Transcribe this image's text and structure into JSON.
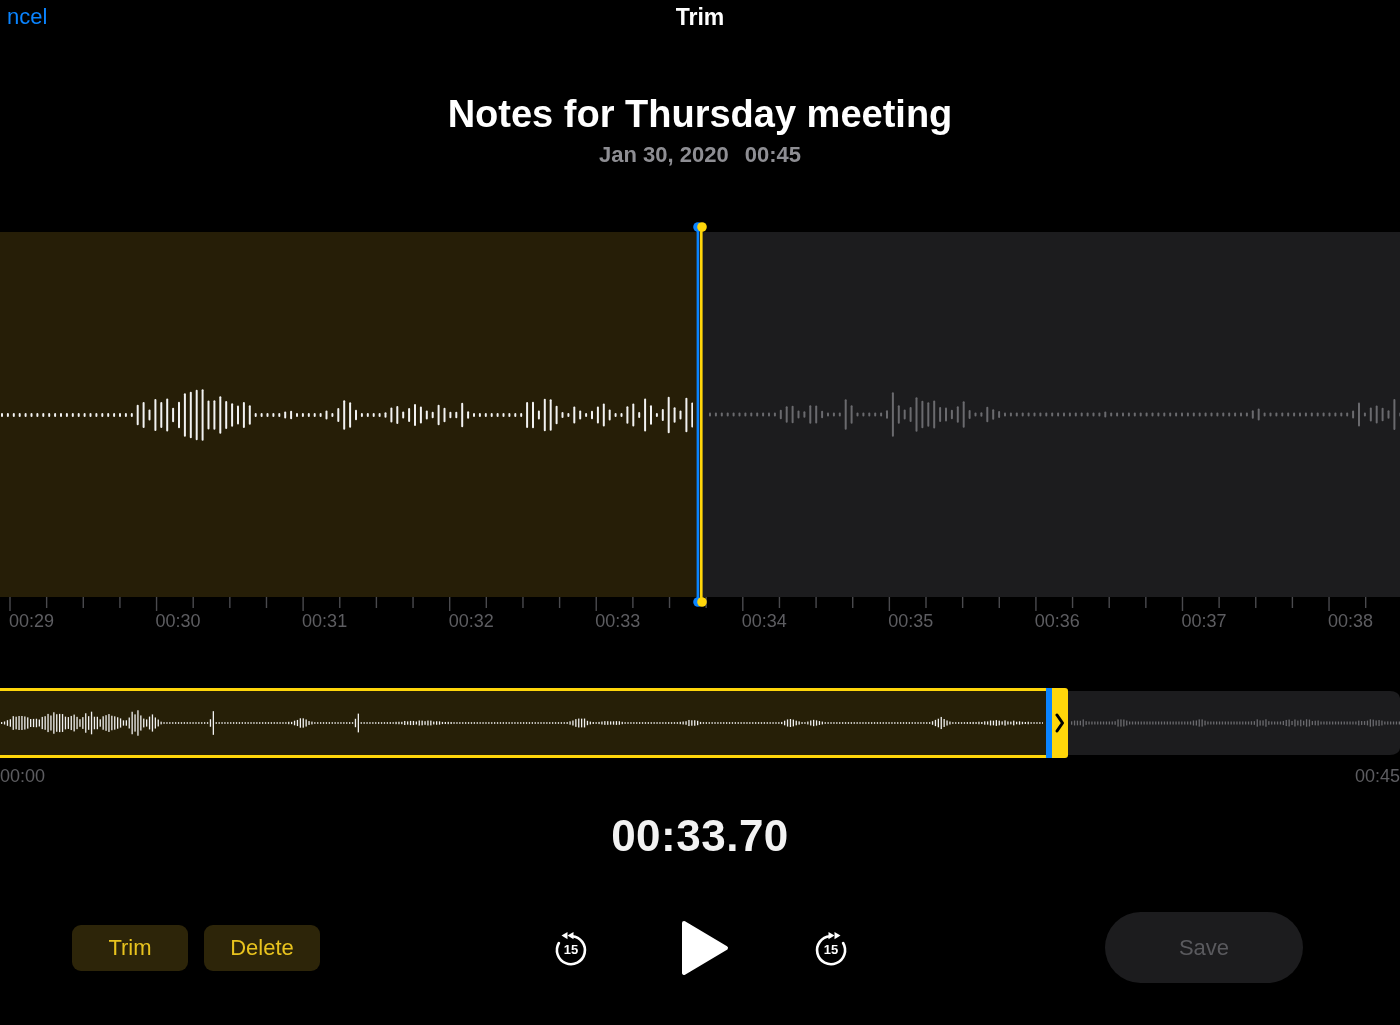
{
  "nav_bar": {
    "cancel_button": "ncel",
    "title": "Trim"
  },
  "recording": {
    "title": "Notes for Thursday meeting",
    "date": "Jan 30, 2020",
    "duration": "00:45"
  },
  "waveform_detail": {
    "level": 0.5,
    "time_ticks": [
      "00:29",
      "00:30",
      "00:31",
      "00:32",
      "00:33",
      "00:34",
      "00:35",
      "00:36",
      "00:37",
      "00:38"
    ]
  },
  "overview": {
    "level": 0.747,
    "start_time": "00:00",
    "end_time": "00:45"
  },
  "current_time": "00:33.70",
  "edit_buttons": [
    {
      "label": "Trim"
    },
    {
      "label": "Delete"
    }
  ],
  "transport": [
    {
      "kind": "skip_back",
      "label": "15"
    },
    {
      "kind": "play"
    },
    {
      "kind": "skip_forward",
      "label": "15"
    }
  ],
  "save_button": {
    "label": "Save",
    "disabled": true
  }
}
